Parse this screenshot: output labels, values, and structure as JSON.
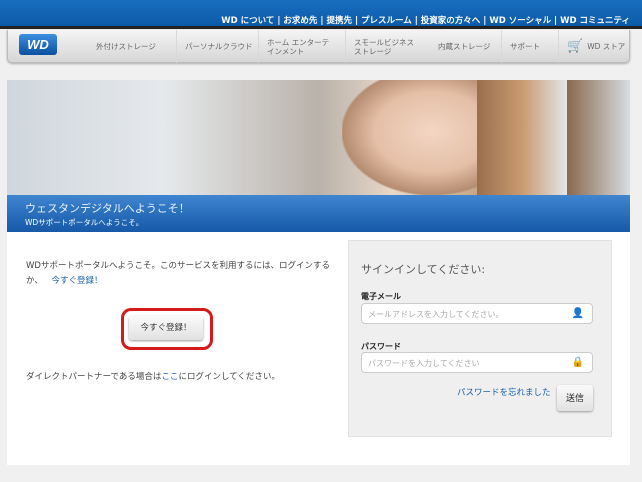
{
  "top_links": [
    "WD について",
    "お求め先",
    "提携先",
    "プレスルーム",
    "投資家の方々へ",
    "WD ソーシャル",
    "WD コミュニティ"
  ],
  "logo": "WD",
  "nav": [
    {
      "label": "外付けストレージ"
    },
    {
      "label": "パーソナルクラウド"
    },
    {
      "label": "ホーム エンターテ\nインメント"
    },
    {
      "label": "スモールビジネス\nストレージ"
    },
    {
      "label": "内蔵ストレージ"
    },
    {
      "label": "サポート"
    },
    {
      "label": "WD ストア",
      "icon": "cart-icon"
    }
  ],
  "banner": {
    "title": "ウェスタンデジタルへようこそ！",
    "subtitle": "WDサポートポータルへようこそ。"
  },
  "intro": {
    "text": "WDサポートポータルへようこそ。このサービスを利用するには、ログインするか、",
    "link": "今すぐ登録！"
  },
  "register_button": "今すぐ登録！",
  "partner": {
    "before": "ダイレクトパートナーである場合は",
    "link": "ここ",
    "after": "にログインしてください。"
  },
  "signin": {
    "title": "サインインしてください:",
    "email_label": "電子メール",
    "email_placeholder": "メールアドレスを入力してください。",
    "password_label": "パスワード",
    "password_placeholder": "パスワードを入力してください",
    "forgot": "パスワードを忘れました",
    "submit": "送信"
  }
}
